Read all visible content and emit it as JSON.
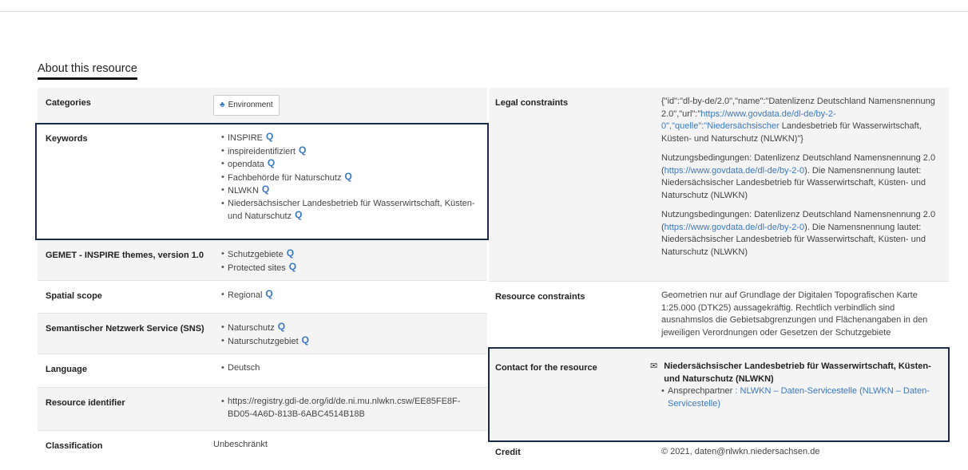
{
  "section_title": "About this resource",
  "left": {
    "categories": {
      "label": "Categories",
      "button": "Environment"
    },
    "keywords": {
      "label": "Keywords",
      "items": [
        "INSPIRE",
        "inspireidentifiziert",
        "opendata",
        "Fachbehörde für Naturschutz",
        "NLWKN",
        "Niedersächsischer Landesbetrieb für Wasserwirtschaft, Küsten- und Naturschutz"
      ]
    },
    "gemet": {
      "label": "GEMET - INSPIRE themes, version 1.0",
      "items": [
        "Schutzgebiete",
        "Protected sites"
      ]
    },
    "spatial": {
      "label": "Spatial scope",
      "items": [
        "Regional"
      ]
    },
    "sns": {
      "label": "Semantischer Netzwerk Service (SNS)",
      "items": [
        "Naturschutz",
        "Naturschutzgebiet"
      ]
    },
    "language": {
      "label": "Language",
      "items": [
        "Deutsch"
      ]
    },
    "identifier": {
      "label": "Resource identifier",
      "items": [
        "https://registry.gdi-de.org/id/de.ni.mu.nlwkn.csw/EE85FE8F-BD05-4A6D-813B-6ABC4514B18B"
      ]
    },
    "classification": {
      "label": "Classification",
      "value": "Unbeschränkt"
    }
  },
  "right": {
    "legal": {
      "label": "Legal constraints",
      "p1_a": "{\"id\":\"dl-by-de/2.0\",\"name\":\"Datenlizenz Deutschland Namensnennung 2.0\",\"url\":\"",
      "p1_link": "https://www.govdata.de/dl-de/by-2-0\",\"quelle\":\"Niedersächsischer",
      "p1_b": " Landesbetrieb für Wasserwirtschaft, Küsten- und Naturschutz (NLWKN)\"}",
      "p2_a": "Nutzungsbedingungen: Datenlizenz Deutschland Namensnennung 2.0 (",
      "p2_link": "https://www.govdata.de/dl-de/by-2-0",
      "p2_b": "). Die Namensnennung lautet: Niedersächsischer Landesbetrieb für Wasserwirtschaft, Küsten- und Naturschutz (NLWKN)",
      "p3_a": "Nutzungsbedingungen: Datenlizenz Deutschland Namensnennung 2.0 (",
      "p3_link": "https://www.govdata.de/dl-de/by-2-0",
      "p3_b": "). Die Namensnennung lautet: Niedersächsischer Landesbetrieb für Wasserwirtschaft, Küsten- und Naturschutz (NLWKN)"
    },
    "resource": {
      "label": "Resource constraints",
      "text": "Geometrien nur auf Grundlage der Digitalen Topografischen Karte 1:25.000 (DTK25) aussagekräftig. Rechtlich verbindlich sind ausnahmslos die Gebietsabgrenzungen und Flächenangaben in den jeweiligen Verordnungen oder Gesetzen der Schutzgebiete"
    },
    "contact": {
      "label": "Contact for the resource",
      "org": "Niedersächsischer Landesbetrieb für Wasserwirtschaft, Küsten- und Naturschutz (NLWKN)",
      "role": "Ansprechpartner",
      "sep": " : ",
      "link": "NLWKN – Daten-Servicestelle (NLWKN – Daten-Servicestelle)"
    },
    "credit": {
      "label": "Credit",
      "text": "© 2021, daten@nlwkn.niedersachsen.de"
    }
  }
}
